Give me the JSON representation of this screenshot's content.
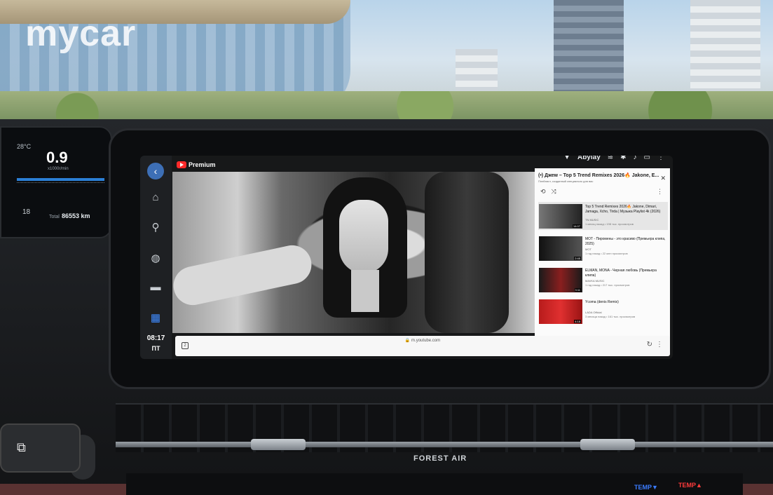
{
  "watermark": "mycar",
  "cluster": {
    "outside_temp": "28°C",
    "speed_value": "0.9",
    "speed_unit": "x1000r/min",
    "gear": "18",
    "odo_label": "Total",
    "odo_value": "86553 km"
  },
  "sidebar": {
    "back_icon": "chevron-left-icon",
    "items": [
      {
        "name": "home",
        "icon": "home-icon",
        "glyph": "⌂"
      },
      {
        "name": "navigation",
        "icon": "location-pin-icon",
        "glyph": "⚲"
      },
      {
        "name": "browser",
        "icon": "globe-icon",
        "glyph": "◍"
      },
      {
        "name": "car",
        "icon": "car-icon",
        "glyph": "▬"
      },
      {
        "name": "apps",
        "icon": "apps-grid-icon",
        "glyph": "▦"
      }
    ],
    "time": "08:17",
    "day": "ПТ"
  },
  "topbar": {
    "app_name": "Premium",
    "user": "Abylay",
    "icons": [
      "shield-icon",
      "wifi-icon",
      "bluetooth-icon",
      "microphone-icon",
      "screen-cast-icon",
      "more-vert-icon"
    ]
  },
  "playlist": {
    "header": "(•) Джем – Top 5 Trend Remixes 2026🔥 Jakone, E...",
    "subheader": "Плейлист, созданный специально для вас",
    "items": [
      {
        "title": "Top 5 Trend Remixes 2026🔥 Jakone, Dimari, Jamaga, Xcho, Tirda | Музыка Playlist 4k (2026)",
        "channel": "TN MUSIC",
        "meta": "1 месяц назад • 198 тыс. просмотров",
        "duration": "14:07",
        "active": true
      },
      {
        "title": "MOT - Пиромены - это красиво (Премьера клипа, 2025)",
        "channel": "MOT",
        "meta": "1 год назад • 22 млн просмотров",
        "duration": "2:45",
        "active": false
      },
      {
        "title": "ELMAN, MONA - Черная любовь (Премьера клипа)",
        "channel": "MAVKA MUSIC",
        "meta": "1 год назад • 217 тыс. просмотров",
        "duration": "3:11",
        "active": false
      },
      {
        "title": "Ycoma (denis Remix)",
        "channel": "LADA Official",
        "meta": "3 месяца назад • 161 тыс. просмотров",
        "duration": "4:18",
        "active": false
      }
    ]
  },
  "urlbar": {
    "url": "🔒 m.youtube.com",
    "tabs_count": "2"
  },
  "console": {
    "brand": "FOREST AIR",
    "temp_minus": "TEMP▼",
    "temp_plus": "TEMP▲"
  },
  "colors": {
    "accent": "#3f8bff",
    "youtube_red": "#ff2a2a"
  }
}
